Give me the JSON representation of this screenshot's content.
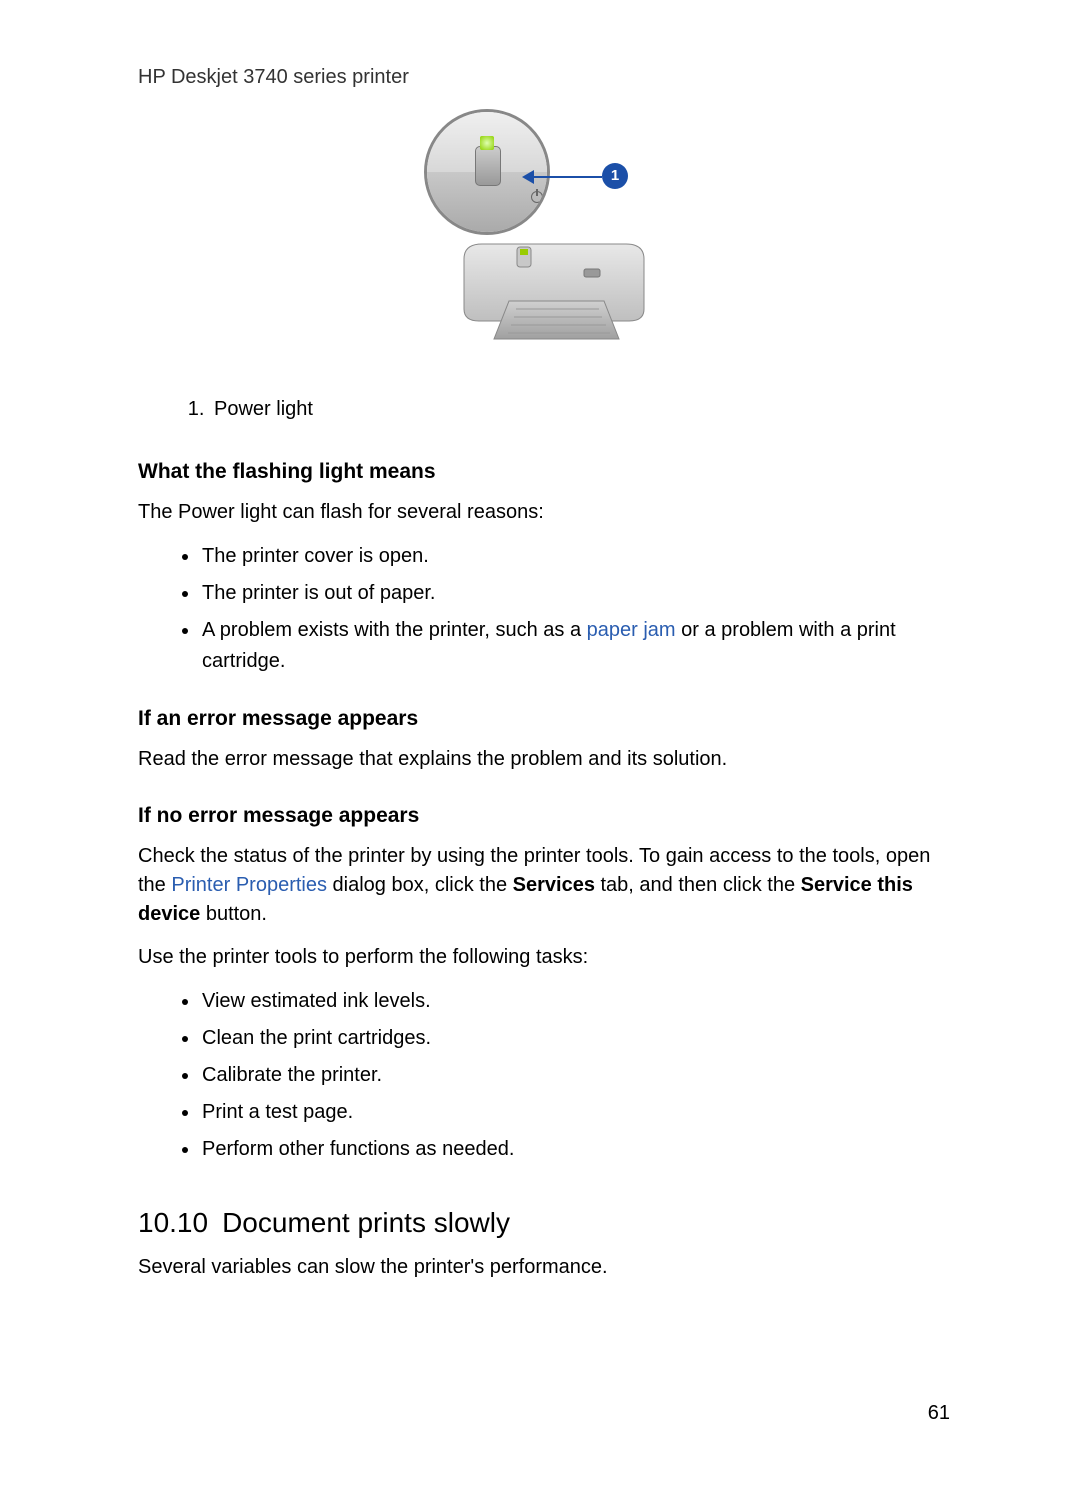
{
  "header": {
    "title": "HP Deskjet 3740 series printer"
  },
  "figure": {
    "callout_number": "1",
    "caption_item": "Power light"
  },
  "sections": {
    "flash": {
      "heading": "What the flashing light means",
      "intro": "The Power light can flash for several reasons:",
      "bullets": {
        "b1": "The printer cover is open.",
        "b2": "The printer is out of paper.",
        "b3a": "A problem exists with the printer, such as a ",
        "b3_link": "paper jam",
        "b3b": " or a problem with a print cartridge."
      }
    },
    "err": {
      "heading": "If an error message appears",
      "para": "Read the error message that explains the problem and its solution."
    },
    "noerr": {
      "heading": "If no error message appears",
      "p1a": "Check the status of the printer by using the printer tools. To gain access to the tools, open the ",
      "p1_link": "Printer Properties",
      "p1b": " dialog box, click the ",
      "p1_bold1": "Services",
      "p1c": " tab, and then click the ",
      "p1_bold2": "Service this device",
      "p1d": " button.",
      "p2": "Use the printer tools to perform the following tasks:",
      "bullets": {
        "b1": "View estimated ink levels.",
        "b2": "Clean the print cartridges.",
        "b3": "Calibrate the printer.",
        "b4": "Print a test page.",
        "b5": "Perform other functions as needed."
      }
    },
    "slow": {
      "number": "10.10",
      "title": "Document prints slowly",
      "para": "Several variables can slow the printer's performance."
    }
  },
  "page_number": "61"
}
